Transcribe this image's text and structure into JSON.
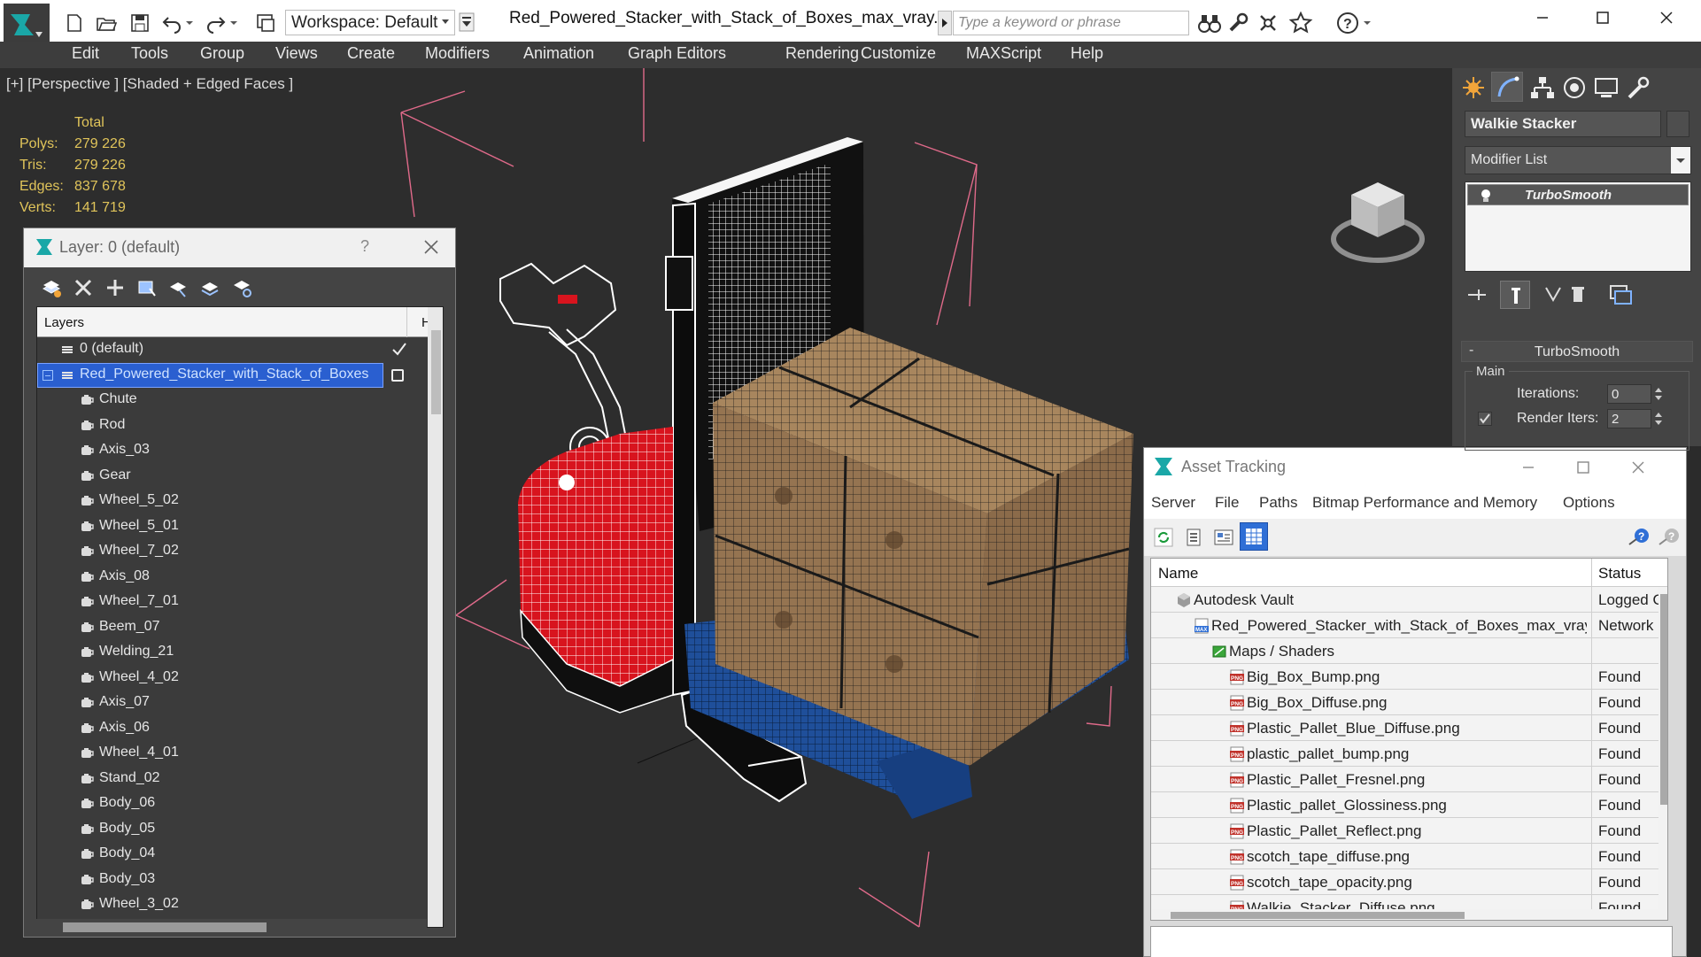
{
  "app": {
    "document_title": "Red_Powered_Stacker_with_Stack_of_Boxes_max_vray.max",
    "workspace": "Workspace: Default",
    "search_placeholder": "Type a keyword or phrase"
  },
  "menu": [
    "Edit",
    "Tools",
    "Group",
    "Views",
    "Create",
    "Modifiers",
    "Animation",
    "Graph Editors",
    "Rendering",
    "Customize",
    "MAXScript",
    "Help"
  ],
  "viewport": {
    "label": "[+] [Perspective ] [Shaded + Edged Faces ]",
    "stats": {
      "header": "Total",
      "rows": [
        {
          "label": "Polys:",
          "value": "279 226"
        },
        {
          "label": "Tris:",
          "value": "279 226"
        },
        {
          "label": "Edges:",
          "value": "837 678"
        },
        {
          "label": "Verts:",
          "value": "141 719"
        }
      ]
    }
  },
  "layer_dialog": {
    "title": "Layer: 0 (default)",
    "help": "?",
    "column_layers": "Layers",
    "column_hide": "H",
    "items": [
      {
        "label": "0 (default)",
        "type": "layer",
        "checked": true
      },
      {
        "label": "Red_Powered_Stacker_with_Stack_of_Boxes",
        "type": "layer",
        "selected": true
      },
      {
        "label": "Chute",
        "type": "object"
      },
      {
        "label": "Rod",
        "type": "object"
      },
      {
        "label": "Axis_03",
        "type": "object"
      },
      {
        "label": "Gear",
        "type": "object"
      },
      {
        "label": "Wheel_5_02",
        "type": "object"
      },
      {
        "label": "Wheel_5_01",
        "type": "object"
      },
      {
        "label": "Wheel_7_02",
        "type": "object"
      },
      {
        "label": "Axis_08",
        "type": "object"
      },
      {
        "label": "Wheel_7_01",
        "type": "object"
      },
      {
        "label": "Beem_07",
        "type": "object"
      },
      {
        "label": "Welding_21",
        "type": "object"
      },
      {
        "label": "Wheel_4_02",
        "type": "object"
      },
      {
        "label": "Axis_07",
        "type": "object"
      },
      {
        "label": "Axis_06",
        "type": "object"
      },
      {
        "label": "Wheel_4_01",
        "type": "object"
      },
      {
        "label": "Stand_02",
        "type": "object"
      },
      {
        "label": "Body_06",
        "type": "object"
      },
      {
        "label": "Body_05",
        "type": "object"
      },
      {
        "label": "Body_04",
        "type": "object"
      },
      {
        "label": "Body_03",
        "type": "object"
      },
      {
        "label": "Wheel_3_02",
        "type": "object"
      }
    ]
  },
  "asset_tracking": {
    "title": "Asset Tracking",
    "menu": [
      "Server",
      "File",
      "Paths",
      "Bitmap Performance and Memory",
      "Options"
    ],
    "col_name": "Name",
    "col_status": "Status",
    "rows": [
      {
        "name": "Autodesk Vault",
        "status": "Logged Out",
        "icon": "vault-icon",
        "indent": 1
      },
      {
        "name": "Red_Powered_Stacker_with_Stack_of_Boxes_max_vray.max",
        "status": "Network",
        "icon": "max-file-icon",
        "indent": 2
      },
      {
        "name": "Maps / Shaders",
        "status": "",
        "icon": "maps-icon",
        "indent": 3
      },
      {
        "name": "Big_Box_Bump.png",
        "status": "Found",
        "icon": "png-icon",
        "indent": 4
      },
      {
        "name": "Big_Box_Diffuse.png",
        "status": "Found",
        "icon": "png-icon",
        "indent": 4
      },
      {
        "name": "Plastic_Pallet_Blue_Diffuse.png",
        "status": "Found",
        "icon": "png-icon",
        "indent": 4
      },
      {
        "name": "plastic_pallet_bump.png",
        "status": "Found",
        "icon": "png-icon",
        "indent": 4
      },
      {
        "name": "Plastic_Pallet_Fresnel.png",
        "status": "Found",
        "icon": "png-icon",
        "indent": 4
      },
      {
        "name": "Plastic_pallet_Glossiness.png",
        "status": "Found",
        "icon": "png-icon",
        "indent": 4
      },
      {
        "name": "Plastic_Pallet_Reflect.png",
        "status": "Found",
        "icon": "png-icon",
        "indent": 4
      },
      {
        "name": "scotch_tape_diffuse.png",
        "status": "Found",
        "icon": "png-icon",
        "indent": 4
      },
      {
        "name": "scotch_tape_opacity.png",
        "status": "Found",
        "icon": "png-icon",
        "indent": 4
      },
      {
        "name": "Walkie_Stacker_Diffuse.png",
        "status": "Found",
        "icon": "png-icon",
        "indent": 4
      }
    ]
  },
  "command_panel": {
    "object_name": "Walkie Stacker",
    "modifier_list": "Modifier List",
    "stack": [
      "TurboSmooth"
    ],
    "rollout_title": "TurboSmooth",
    "group_main": "Main",
    "iterations_label": "Iterations:",
    "iterations_value": "0",
    "render_iters_label": "Render Iters:",
    "render_iters_value": "2",
    "render_iters_checked": true
  },
  "colors": {
    "viewport_bg": "#2d2d2d",
    "selection_blue": "#2a5fd0",
    "stats_yellow": "#e0c45a",
    "stacker_red": "#d8141e",
    "pallet_blue": "#1f4f9a",
    "box_brown": "#9c7a55",
    "gizmo_pink": "#e06a8a"
  }
}
